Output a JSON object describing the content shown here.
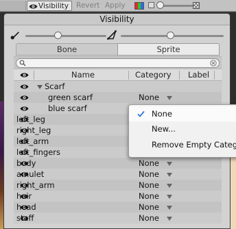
{
  "toolbar": {
    "visibility_label": "Visibility",
    "revert_label": "Revert",
    "apply_label": "Apply"
  },
  "panel": {
    "title": "Visibility",
    "tabs": [
      "Bone",
      "Sprite"
    ],
    "active_tab": "Sprite",
    "search": {
      "value": "",
      "placeholder": ""
    },
    "columns": [
      "Name",
      "Category",
      "Label"
    ],
    "rows": [
      {
        "name": "Scarf",
        "category": "",
        "group": true,
        "indent": 1
      },
      {
        "name": "green scarf",
        "category": "None",
        "indent": 2
      },
      {
        "name": "blue scarf",
        "category": "",
        "indent": 2
      },
      {
        "name": "left_leg",
        "category": "",
        "indent": 0
      },
      {
        "name": "right_leg",
        "category": "",
        "indent": 0
      },
      {
        "name": "left_arm",
        "category": "",
        "indent": 0
      },
      {
        "name": "left_fingers",
        "category": "",
        "indent": 0
      },
      {
        "name": "body",
        "category": "None",
        "indent": 0
      },
      {
        "name": "amulet",
        "category": "None",
        "indent": 0
      },
      {
        "name": "right_arm",
        "category": "None",
        "indent": 0
      },
      {
        "name": "hair",
        "category": "None",
        "indent": 0
      },
      {
        "name": "head",
        "category": "None",
        "indent": 0
      },
      {
        "name": "staff",
        "category": "None",
        "indent": 0
      }
    ]
  },
  "category_menu": {
    "items": [
      "None",
      "New...",
      "Remove Empty Categor"
    ],
    "checked": "None"
  },
  "colors": {
    "panel_bg": "#d2d2d2",
    "check_blue": "#2f78d8"
  }
}
